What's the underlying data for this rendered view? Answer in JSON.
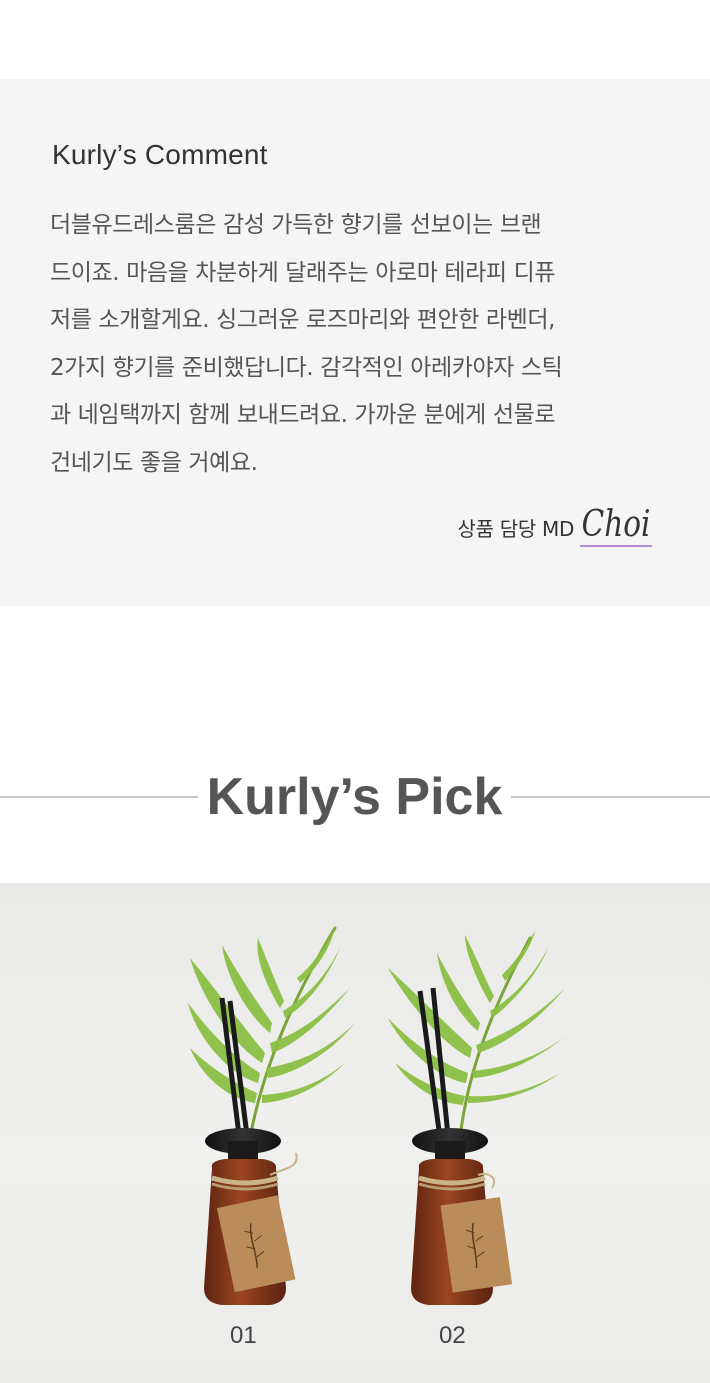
{
  "comment": {
    "title": "Kurly’s Comment",
    "lines": [
      "더블유드레스룸은 감성 가득한 향기를 선보이는 브랜",
      "드이죠. 마음을 차분하게 달래주는 아로마 테라피 디퓨",
      "저를 소개할게요. 싱그러운 로즈마리와 편안한 라벤더,",
      "2가지 향기를 준비했답니다. 감각적인 아레카야자 스틱",
      "과 네임택까지 함께 보내드려요. 가까운 분에게 선물로",
      "건네기도 좋을 거예요."
    ],
    "md_label": "상품 담당 MD",
    "md_name": "Choi"
  },
  "pick": {
    "title": "Kurly’s Pick"
  },
  "products": [
    {
      "number": "01"
    },
    {
      "number": "02"
    }
  ],
  "colors": {
    "comment_bg": "#f5f5f5",
    "signature_underline": "#b48cd3",
    "divider": "#c8c8c8",
    "bottle": "#8a3b1a"
  }
}
